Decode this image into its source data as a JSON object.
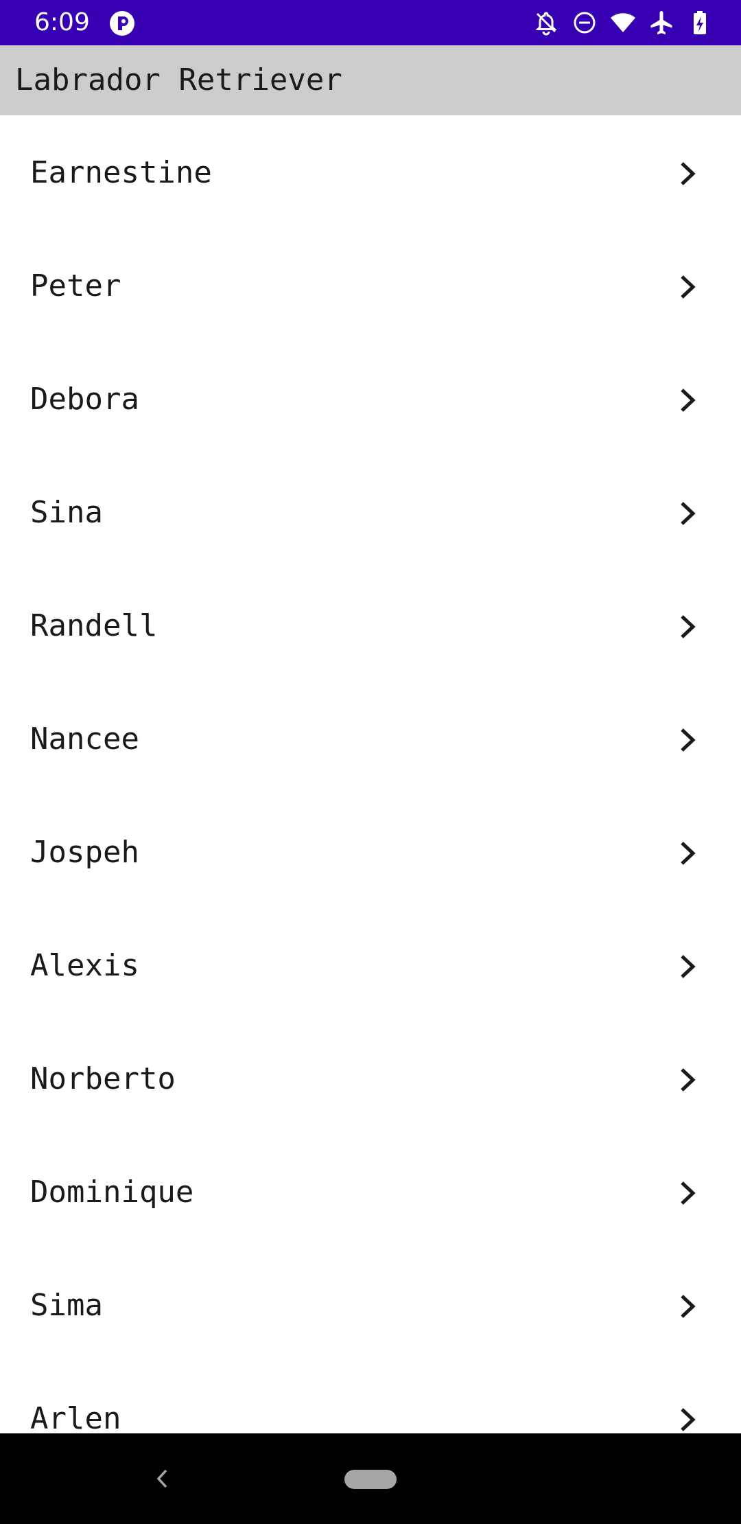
{
  "status_bar": {
    "time": "6:09",
    "background": "#3700b3",
    "icons": [
      "app-notification-icon",
      "notifications-off-icon",
      "do-not-disturb-icon",
      "wifi-icon",
      "airplane-mode-icon",
      "battery-charging-icon"
    ]
  },
  "app_bar": {
    "title": "Labrador Retriever",
    "background": "#cccccc"
  },
  "list": {
    "items": [
      {
        "label": "Earnestine"
      },
      {
        "label": "Peter"
      },
      {
        "label": "Debora"
      },
      {
        "label": "Sina"
      },
      {
        "label": "Randell"
      },
      {
        "label": "Nancee"
      },
      {
        "label": "Jospeh"
      },
      {
        "label": "Alexis"
      },
      {
        "label": "Norberto"
      },
      {
        "label": "Dominique"
      },
      {
        "label": "Sima"
      },
      {
        "label": "Arlen"
      }
    ],
    "trailing_icon": "chevron-right-icon"
  },
  "nav_bar": {
    "background": "#000000",
    "icons": [
      "back-icon",
      "home-pill-icon"
    ]
  }
}
